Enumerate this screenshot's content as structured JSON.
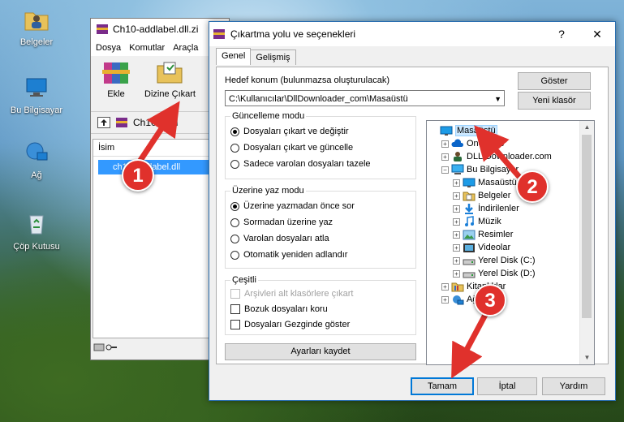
{
  "desktop": {
    "icons": [
      {
        "label": "Belgeler",
        "icon": "documents-folder-icon"
      },
      {
        "label": "Bu Bilgisayar",
        "icon": "this-pc-icon"
      },
      {
        "label": "Ağ",
        "icon": "network-icon"
      },
      {
        "label": "Çöp Kutusu",
        "icon": "recycle-bin-icon"
      }
    ]
  },
  "winrar": {
    "title": "Ch10-addlabel.dll.zi",
    "menu": [
      "Dosya",
      "Komutlar",
      "Araçla"
    ],
    "toolbar": {
      "extract_label": "Ekle",
      "extract_to_label": "Dizine Çıkart"
    },
    "path_text": "Ch10-addl",
    "list_header": "İsim",
    "selected_file": "ch10-addlabel.dll"
  },
  "dialog": {
    "title": "Çıkartma yolu ve seçenekleri",
    "help_glyph": "?",
    "close_glyph": "✕",
    "tabs": [
      "Genel",
      "Gelişmiş"
    ],
    "destination_label": "Hedef konum (bulunmazsa oluşturulacak)",
    "destination_value": "C:\\Kullanıcılar\\DllDownloader_com\\Masaüstü",
    "show_button": "Göster",
    "new_folder_button": "Yeni klasör",
    "update_mode": {
      "title": "Güncelleme modu",
      "options": [
        "Dosyaları çıkart ve değiştir",
        "Dosyaları çıkart ve güncelle",
        "Sadece varolan dosyaları tazele"
      ],
      "selected": 0
    },
    "overwrite_mode": {
      "title": "Üzerine yaz modu",
      "options": [
        "Üzerine yazmadan önce sor",
        "Sormadan üzerine yaz",
        "Varolan dosyaları atla",
        "Otomatik yeniden adlandır"
      ],
      "selected": 0
    },
    "misc": {
      "title": "Çeşitli",
      "options": [
        {
          "label": "Arşivleri alt klasörlere çıkart",
          "disabled": true
        },
        {
          "label": "Bozuk dosyaları koru",
          "disabled": false
        },
        {
          "label": "Dosyaları Gezginde göster",
          "disabled": false
        }
      ]
    },
    "save_settings_button": "Ayarları kaydet",
    "tree": [
      {
        "label": "Masaüstü",
        "icon": "desktop-folder-icon",
        "level": 0,
        "expander": "",
        "selected": true
      },
      {
        "label": "OneDrive",
        "icon": "onedrive-cloud-icon",
        "level": 1,
        "expander": "+"
      },
      {
        "label": "DLL Downloader.com",
        "icon": "user-folder-icon",
        "level": 1,
        "expander": "+"
      },
      {
        "label": "Bu Bilgisayar",
        "icon": "computer-icon",
        "level": 1,
        "expander": "−"
      },
      {
        "label": "Masaüstü",
        "icon": "desktop-folder-icon",
        "level": 2,
        "expander": "+"
      },
      {
        "label": "Belgeler",
        "icon": "documents-folder-icon",
        "level": 2,
        "expander": "+"
      },
      {
        "label": "İndirilenler",
        "icon": "downloads-folder-icon",
        "level": 2,
        "expander": "+"
      },
      {
        "label": "Müzik",
        "icon": "music-folder-icon",
        "level": 2,
        "expander": "+"
      },
      {
        "label": "Resimler",
        "icon": "pictures-folder-icon",
        "level": 2,
        "expander": "+"
      },
      {
        "label": "Videolar",
        "icon": "videos-folder-icon",
        "level": 2,
        "expander": "+"
      },
      {
        "label": "Yerel Disk (C:)",
        "icon": "local-disk-icon",
        "level": 2,
        "expander": "+"
      },
      {
        "label": "Yerel Disk (D:)",
        "icon": "local-disk-icon",
        "level": 2,
        "expander": "+"
      },
      {
        "label": "Kitaplıklar",
        "icon": "libraries-folder-icon",
        "level": 1,
        "expander": "+"
      },
      {
        "label": "Ağ",
        "icon": "network-icon",
        "level": 1,
        "expander": "+"
      }
    ],
    "ok_button": "Tamam",
    "cancel_button": "İptal",
    "help_button": "Yardım"
  },
  "callouts": [
    "1",
    "2",
    "3"
  ],
  "colors": {
    "callout": "#e0312c",
    "selection": "#3399ff",
    "default_button_border": "#0078d7"
  }
}
